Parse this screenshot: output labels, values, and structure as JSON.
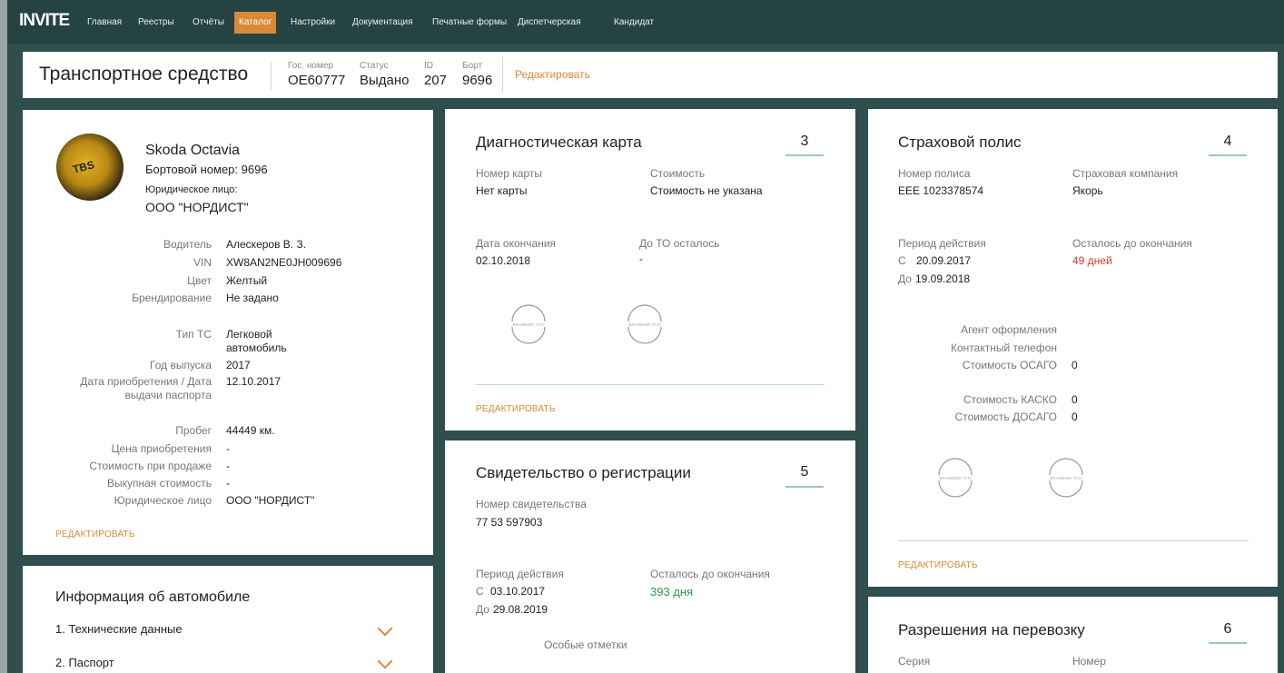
{
  "app": {
    "logo": "INVITE"
  },
  "nav": {
    "items": [
      "Главная",
      "Реестры",
      "Отчёты",
      "Каталог",
      "Настройки",
      "Документация",
      "Печатные формы",
      "Диспетчерская",
      "Кандидат"
    ],
    "active": "Каталог"
  },
  "header": {
    "title": "Транспортное средство",
    "fields": [
      {
        "label": "Гос. номер",
        "value": "ОЕ60777"
      },
      {
        "label": "Статус",
        "value": "Выдано"
      },
      {
        "label": "ID",
        "value": "207"
      },
      {
        "label": "Борт",
        "value": "9696"
      }
    ],
    "edit": "Редактировать"
  },
  "vehicle": {
    "model": "Skoda Octavia",
    "board_line": "Бортовой номер: 9696",
    "legal_label": "Юридическое лицо:",
    "legal_value": "ООО \"НОРДИСТ\"",
    "avatar_text": "TBS",
    "details": [
      {
        "label": "Водитель",
        "value": "Алескеров В. З."
      },
      {
        "label": "VIN",
        "value": "XW8AN2NE0JH009696"
      },
      {
        "label": "Цвет",
        "value": "Желтый"
      },
      {
        "label": "Брендирование",
        "value": "Не задано"
      },
      {
        "label": "Тип ТС",
        "value": "Легковой автомобиль"
      },
      {
        "label": "Год выпуска",
        "value": "2017"
      },
      {
        "label": "Дата приобретения / Дата выдачи паспорта",
        "value": "12.10.2017"
      },
      {
        "label": "Пробег",
        "value": "44449 км."
      },
      {
        "label": "Цена приобретения",
        "value": "-"
      },
      {
        "label": "Стоимость при продаже",
        "value": "-"
      },
      {
        "label": "Выкупная стоимость",
        "value": "-"
      },
      {
        "label": "Юридическое лицо",
        "value": "ООО \"НОРДИСТ\""
      }
    ],
    "edit": "РЕДАКТИРОВАТЬ"
  },
  "car_info": {
    "title": "Информация об автомобиле",
    "items": [
      "1. Технические данные",
      "2. Паспорт"
    ]
  },
  "diag": {
    "title": "Диагностическая карта",
    "count": "3",
    "card_no_label": "Номер карты",
    "card_no_value": "Нет карты",
    "cost_label": "Стоимость",
    "cost_value": "Стоимость не указана",
    "end_label": "Дата окончания",
    "end_value": "02.10.2018",
    "to_label": "До ТО осталось",
    "to_value": "-",
    "stamp_text": "BRANDING TAXI",
    "edit": "РЕДАКТИРОВАТЬ"
  },
  "reg": {
    "title": "Свидетельство о регистрации",
    "count": "5",
    "no_label": "Номер свидетельства",
    "no_value": "77 53 597903",
    "period_label": "Период действия",
    "from_prefix": "С",
    "from_value": "03.10.2017",
    "to_prefix": "До",
    "to_value": "29.08.2019",
    "left_label": "Осталось до окончания",
    "left_value": "393 дня",
    "notes_label": "Особые отметки"
  },
  "ins": {
    "title": "Страховой полис",
    "count": "4",
    "policy_label": "Номер полиса",
    "policy_value": "ЕЕЕ 1023378574",
    "company_label": "Страховая компания",
    "company_value": "Якорь",
    "period_label": "Период действия",
    "from_prefix": "С",
    "from_value": "20.09.2017",
    "to_prefix": "До",
    "to_value": "19.09.2018",
    "left_label": "Осталось до окончания",
    "left_value": "49 дней",
    "agent_label": "Агент оформления",
    "phone_label": "Контактный телефон",
    "osago_label": "Стоимость ОСАГО",
    "osago_value": "0",
    "kasko_label": "Стоимость КАСКО",
    "kasko_value": "0",
    "dosago_label": "Стоимость ДОСАГО",
    "dosago_value": "0",
    "stamp_text": "BRANDING TAXI",
    "edit": "РЕДАКТИРОВАТЬ"
  },
  "permits": {
    "title": "Разрешения на перевозку",
    "count": "6",
    "series_label": "Серия",
    "number_label": "Номер"
  },
  "colors": {
    "bg": "#2f4e4e",
    "nav": "#254343",
    "accent": "#d98a36",
    "green": "#2f9b4e",
    "red": "#cf3a30"
  }
}
